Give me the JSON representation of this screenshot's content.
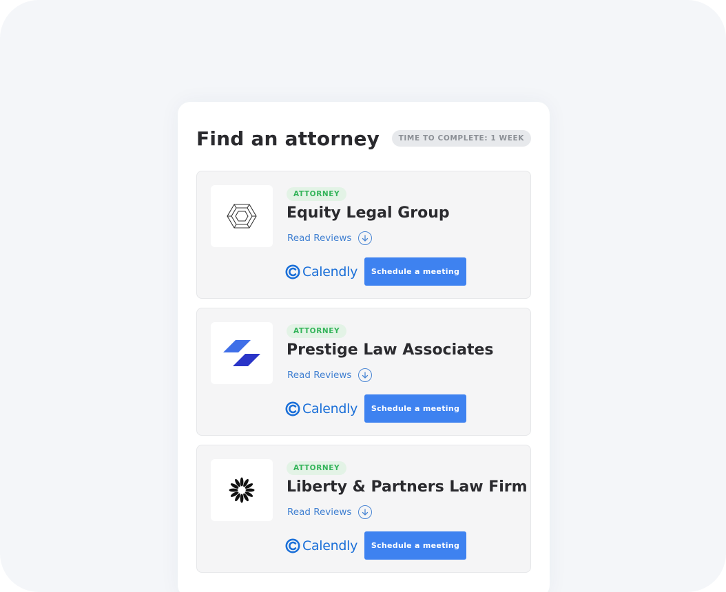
{
  "header": {
    "title": "Find an attorney",
    "time_badge": "TIME TO COMPLETE: 1 WEEK"
  },
  "firms": [
    {
      "tag": "ATTORNEY",
      "name": "Equity Legal Group",
      "reviews_label": "Read Reviews",
      "calendly_label": "Calendly",
      "schedule_label": "Schedule a meeting",
      "logo_icon": "hexagon-outline-icon"
    },
    {
      "tag": "ATTORNEY",
      "name": "Prestige Law Associates",
      "reviews_label": "Read Reviews",
      "calendly_label": "Calendly",
      "schedule_label": "Schedule a meeting",
      "logo_icon": "blue-parallelograms-icon"
    },
    {
      "tag": "ATTORNEY",
      "name": "Liberty & Partners Law Firm",
      "reviews_label": "Read Reviews",
      "calendly_label": "Calendly",
      "schedule_label": "Schedule a meeting",
      "logo_icon": "black-starburst-icon"
    }
  ],
  "colors": {
    "accent": "#3e82f0",
    "link": "#3f7fd1",
    "tag_text": "#34b45a",
    "tag_bg": "#e3f3e6",
    "calendly": "#1a6fd8"
  }
}
